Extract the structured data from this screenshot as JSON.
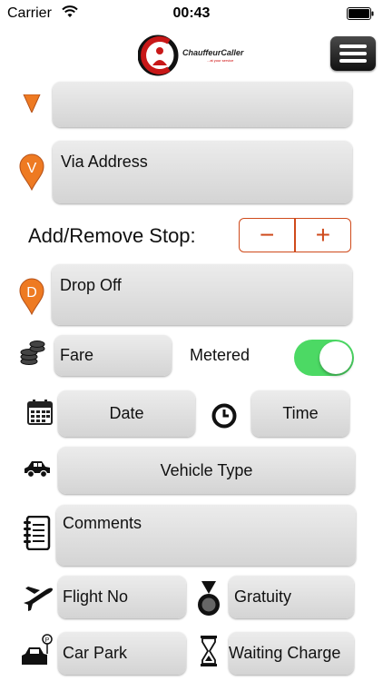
{
  "status": {
    "carrier": "Carrier",
    "time": "00:43"
  },
  "brand": {
    "name": "ChauffeurCaller",
    "tagline": "...at your service"
  },
  "form": {
    "via_placeholder": "Via Address",
    "add_remove_label": "Add/Remove Stop:",
    "minus": "−",
    "plus": "+",
    "drop_off_placeholder": "Drop Off",
    "fare_placeholder": "Fare",
    "metered_label": "Metered",
    "metered_on": true,
    "date_label": "Date",
    "time_label": "Time",
    "vehicle_type_label": "Vehicle Type",
    "comments_placeholder": "Comments",
    "flight_no_placeholder": "Flight No",
    "gratuity_placeholder": "Gratuity",
    "car_park_placeholder": "Car Park",
    "waiting_charge_placeholder": "Waiting Charge"
  },
  "markers": {
    "via_letter": "V",
    "drop_letter": "D"
  },
  "colors": {
    "accent": "#cf4a1b",
    "marker": "#ee7a22",
    "toggle_on": "#4cd964"
  },
  "icons": [
    "wifi-icon",
    "battery-icon",
    "menu-icon",
    "location-pin-icon",
    "coins-icon",
    "calendar-icon",
    "clock-icon",
    "car-icon",
    "notebook-icon",
    "airplane-icon",
    "medal-icon",
    "parking-car-icon",
    "hourglass-icon"
  ]
}
